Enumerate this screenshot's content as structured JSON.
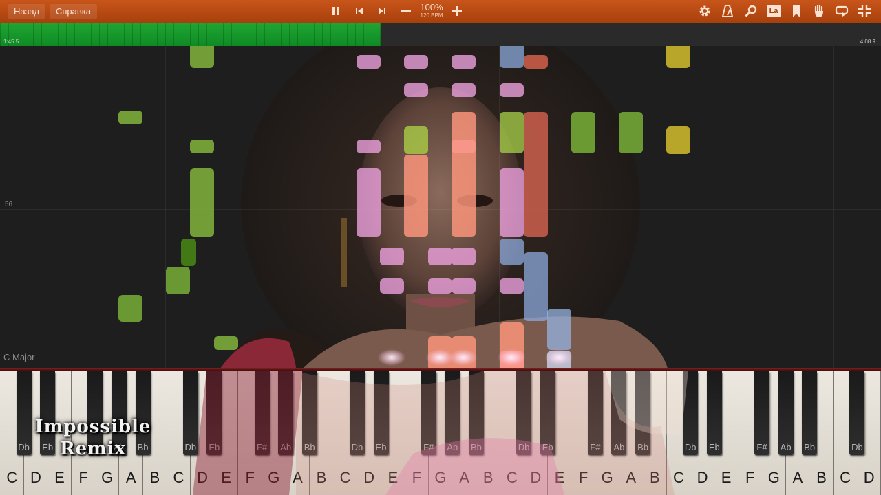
{
  "toolbar": {
    "back_label": "Назад",
    "help_label": "Справка",
    "zoom_value": "100%",
    "tempo": "120 BPM",
    "icons": [
      "pause-icon",
      "skip-back-icon",
      "skip-forward-icon",
      "zoom-out-icon",
      "zoom-in-icon",
      "settings-gear-icon",
      "metronome-icon",
      "search-icon",
      "note-names-icon",
      "bookmark-icon",
      "hand-icon",
      "loop-icon",
      "fullscreen-exit-icon"
    ],
    "note_names_label": "La"
  },
  "progress": {
    "current_time": "1:45.5",
    "total_time": "4:08.9",
    "fraction": 0.432,
    "color": "#1fa632"
  },
  "roll": {
    "measure_number": "56",
    "key_signature": "C Major"
  },
  "keyboard": {
    "white_keys": [
      "C",
      "D",
      "E",
      "F",
      "G",
      "A",
      "B",
      "C",
      "D",
      "E",
      "F",
      "G",
      "A",
      "B",
      "C",
      "D",
      "E",
      "F",
      "G",
      "A",
      "B",
      "C",
      "D",
      "E",
      "F",
      "G",
      "A",
      "B",
      "C",
      "D",
      "E",
      "F",
      "G",
      "A",
      "B",
      "C",
      "D"
    ],
    "black_keys": [
      "Db",
      "Eb",
      "",
      "Ab",
      "Bb",
      "Db",
      "Eb",
      "F#",
      "Ab",
      "Bb",
      "Db",
      "Eb",
      "F#",
      "Ab",
      "Bb",
      "Db",
      "Eb",
      "F#",
      "Ab",
      "Bb",
      "Db",
      "Eb",
      "F#",
      "Ab",
      "Bb",
      "Db"
    ]
  },
  "logo": {
    "line1": "Impossible",
    "line2": "Remix"
  },
  "colors": {
    "toolbar": "#b84a12",
    "green_note": "#7fb43c",
    "pink_note": "#e9a0d8",
    "salmon_note": "#ff9a80",
    "blue_note": "#8fa8d8",
    "yellow_note": "#d8c030",
    "red_note": "#d0604c"
  }
}
